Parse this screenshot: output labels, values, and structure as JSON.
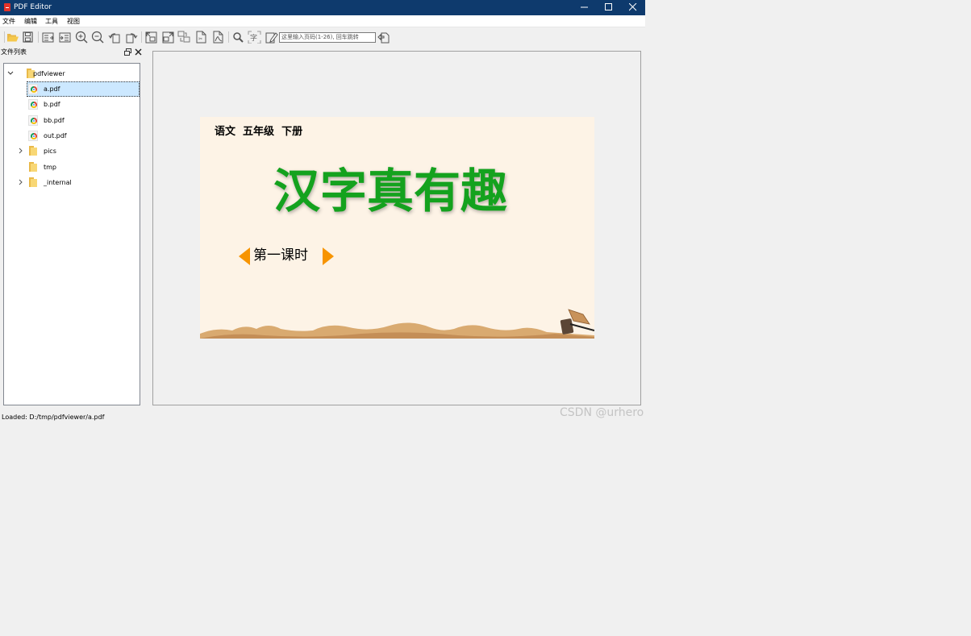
{
  "window": {
    "title": "PDF Editor"
  },
  "menu": [
    "文件",
    "编辑",
    "工具",
    "视图"
  ],
  "toolbar": {
    "page_input_placeholder": "这里输入页码(1-26), 回车跳转",
    "buttons": [
      "open-folder-icon",
      "save-icon",
      "export-icon",
      "import-icon",
      "zoom-in-icon",
      "zoom-out-icon",
      "rotate-left-icon",
      "rotate-right-icon",
      "extract-images-icon",
      "export-images-icon",
      "convert-images-icon",
      "cut-pdf-icon",
      "pdf-icon",
      "search-icon",
      "text-icon",
      "edit-icon",
      "go-page-icon"
    ]
  },
  "file_list": {
    "title": "文件列表",
    "root": "pdfviewer",
    "items": [
      {
        "name": "a.pdf",
        "type": "pdf",
        "selected": true
      },
      {
        "name": "b.pdf",
        "type": "pdf"
      },
      {
        "name": "bb.pdf",
        "type": "pdf"
      },
      {
        "name": "out.pdf",
        "type": "pdf"
      },
      {
        "name": "pics",
        "type": "folder",
        "expandable": true
      },
      {
        "name": "tmp",
        "type": "folder",
        "expandable": false
      },
      {
        "name": "_internal",
        "type": "folder",
        "expandable": true
      }
    ]
  },
  "pdf_page": {
    "subject": "语文  五年级  下册",
    "title": "汉字真有趣",
    "lesson": "第一课时"
  },
  "status": "Loaded: D:/tmp/pdfviewer/a.pdf",
  "watermark": "CSDN @urhero",
  "colors": {
    "titlebar": "#0e3a6d",
    "page_bg": "#fdf3e6",
    "title_green": "#14a21e",
    "arrow_orange": "#f79400",
    "selection": "#cce8ff"
  }
}
